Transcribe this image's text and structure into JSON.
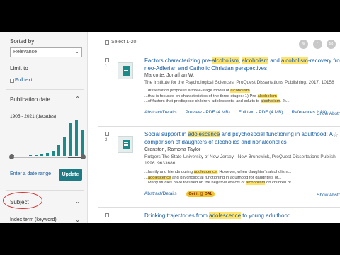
{
  "sidebar": {
    "sorted_by_label": "Sorted by",
    "sort_value": "Relevance",
    "limit_to_label": "Limit to",
    "full_text_label": "Full text",
    "publication_date_label": "Publication date",
    "date_range_label": "1905 - 2021 (decades)",
    "enter_date_range_label": "Enter a date range",
    "update_label": "Update",
    "subject_label": "Subject",
    "index_term_label": "Index term (keyword)",
    "histogram": [
      {
        "decade": "1900s",
        "count": 1
      },
      {
        "decade": "1910s",
        "count": 0
      },
      {
        "decade": "1920s",
        "count": 0
      },
      {
        "decade": "1930s",
        "count": 1
      },
      {
        "decade": "1940s",
        "count": 1
      },
      {
        "decade": "1950s",
        "count": 2
      },
      {
        "decade": "1960s",
        "count": 3
      },
      {
        "decade": "1970s",
        "count": 6
      },
      {
        "decade": "1980s",
        "count": 12
      },
      {
        "decade": "1990s",
        "count": 22
      },
      {
        "decade": "2000s",
        "count": 38
      },
      {
        "decade": "2010s",
        "count": 40
      },
      {
        "decade": "2020s",
        "count": 30
      }
    ]
  },
  "main": {
    "select_label": "Select 1-20",
    "results": [
      {
        "number": "1",
        "title_parts": [
          {
            "t": "Factors characterizing pre-",
            "hl": false
          },
          {
            "t": "alcoholism",
            "hl": true
          },
          {
            "t": ", ",
            "hl": false
          },
          {
            "t": "alcoholism",
            "hl": true
          },
          {
            "t": " and ",
            "hl": false
          },
          {
            "t": "alcoholism",
            "hl": true
          },
          {
            "t": "-recovery from",
            "hl": false
          }
        ],
        "title_line2": "neo-Adlerian and Catholic Christian perspectives",
        "author": "Marcotte, Jonathan W.",
        "publication": "The Institute for the Psychological Sciences, ProQuest Dissertations Publishing, 2017. 10158",
        "snippets": [
          {
            "pre": "...dissertation proposes a three-stage model of ",
            "hl": "alcoholism",
            "post": "..."
          },
          {
            "pre": "...that is focused on characteristics of the three stages: 1) Pre-",
            "hl": "alcoholism",
            "post": ""
          },
          {
            "pre": "...of factors that predispose children, adolescents, and adults to ",
            "hl": "alcoholism",
            "post": ". 2)..."
          }
        ],
        "links": [
          "Abstract/Details",
          "Preview - PDF (4 MB)",
          "Full text - PDF (4 MB)",
          "References (110)"
        ],
        "show_abstract": "Show Abstr"
      },
      {
        "number": "2",
        "title_parts": [
          {
            "t": "Social support in ",
            "hl": false
          },
          {
            "t": "adolescence",
            "hl": true
          },
          {
            "t": " and psychosocial functioning in adulthood: A",
            "hl": false
          }
        ],
        "title_line2": "comparison of daughters of alcoholics and nonalcoholics",
        "author": "Cranston, Ramona Taylor",
        "publication": "Rutgers The State University of New Jersey - New Brunswick, ProQuest Dissertations Publish",
        "publication2": "1996. 9633686",
        "snippets": [
          {
            "pre": "...family and friends during ",
            "hl": "adolescence",
            "post": ". However, when daughter's alcoholism..."
          },
          {
            "pre": "...",
            "hl": "adolescence",
            "post": " and psychosocial functioning in adulthood for daughters of..."
          },
          {
            "pre": "...Many studies have focused on the negative effects of ",
            "hl": "alcoholism",
            "post": " on children of..."
          }
        ],
        "links": [
          "Abstract/Details"
        ],
        "getit_label": "Get it @ DAL",
        "show_abstract": "Show Abstr"
      },
      {
        "number": "3",
        "title_parts": [
          {
            "t": "Drinking trajectories from ",
            "hl": false
          },
          {
            "t": "adolescence",
            "hl": true
          },
          {
            "t": " to young adulthood",
            "hl": false
          }
        ]
      }
    ],
    "toolbar_icons": [
      "save-icon",
      "cite-icon",
      "email-icon"
    ]
  },
  "colors": {
    "accent": "#1e7b86",
    "link": "#1a5fa5",
    "highlight": "#ffe36b",
    "annotation": "#d93030"
  }
}
